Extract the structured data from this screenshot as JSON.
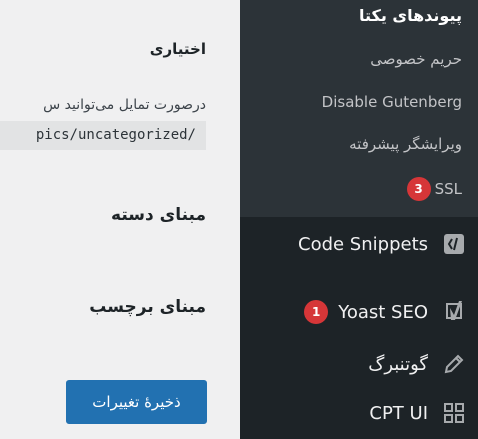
{
  "main": {
    "optional_title": "اختیاری",
    "description": "درصورت تمایل می‌توانید س",
    "code_example": "pics/uncategorized/",
    "category_base_title": "مبنای دسته",
    "tag_base_title": "مبنای برچسب",
    "save_button": "ذخیرهٔ تغییرات"
  },
  "sidebar": {
    "submenu": {
      "current": "پیوندهای یکتا",
      "items": [
        {
          "label": "حریم خصوصی"
        },
        {
          "label": "Disable Gutenberg"
        },
        {
          "label": "ویرایشگر پیشرفته"
        },
        {
          "label": "SSL",
          "badge": "3"
        }
      ]
    },
    "menu": [
      {
        "label": "Code Snippets",
        "icon": "code-snippets-icon"
      },
      {
        "label": "Yoast SEO",
        "badge": "1",
        "icon": "yoast-icon"
      },
      {
        "label": "گوتنبرگ",
        "icon": "pencil-icon"
      },
      {
        "label": "CPT UI",
        "icon": "grid-icon"
      }
    ]
  },
  "colors": {
    "sidebar_bg": "#1d2327",
    "submenu_bg": "#2c3338",
    "badge": "#d63638",
    "primary_button": "#2271b1"
  }
}
